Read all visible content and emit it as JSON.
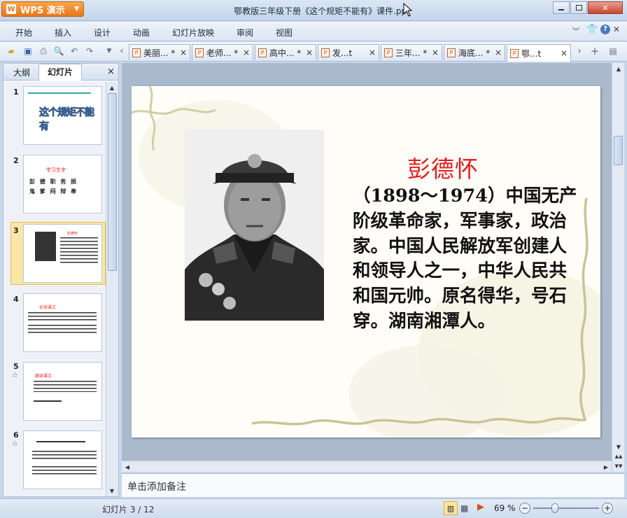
{
  "app": {
    "name": "WPS 演示",
    "window_title": "鄂教版三年级下册《这个规矩不能有》课件.ppt"
  },
  "menu": [
    "开始",
    "插入",
    "设计",
    "动画",
    "幻灯片放映",
    "审阅",
    "视图"
  ],
  "tabs": [
    {
      "label": "美丽... *"
    },
    {
      "label": "老师... *"
    },
    {
      "label": "高中... *"
    },
    {
      "label": "发...t"
    },
    {
      "label": "三年... *"
    },
    {
      "label": "海底... *"
    },
    {
      "label": "鄂...t",
      "active": true
    }
  ],
  "left_pane": {
    "tab_outline": "大纲",
    "tab_slides": "幻灯片",
    "close": "×",
    "thumbnails": [
      {
        "num": "1",
        "title": "这个规矩不能有"
      },
      {
        "num": "2",
        "title": "学习生字",
        "row1": "彭 德 职 务 损",
        "row2": "鬼 爹 闷 辩 奉"
      },
      {
        "num": "3",
        "title": "彭德怀",
        "selected": true
      },
      {
        "num": "4",
        "title": "初读课文"
      },
      {
        "num": "5",
        "title": "细读课文"
      },
      {
        "num": "6",
        "title": "感悟"
      }
    ]
  },
  "slide": {
    "title": "彭德怀",
    "body": "（1898～1974）中国无产阶级革命家，军事家，政治家。中国人民解放军创建人和领导人之一，中华人民共和国元帅。原名得华，号石穿。湖南湘潭人。"
  },
  "notes_placeholder": "单击添加备注",
  "status": {
    "slide_counter": "幻灯片 3 / 12",
    "zoom": "69 %",
    "zoom_level": 69
  },
  "colors": {
    "accent": "#e8761a",
    "slide_title": "#e31b1b",
    "selection": "#fbe6a6"
  }
}
